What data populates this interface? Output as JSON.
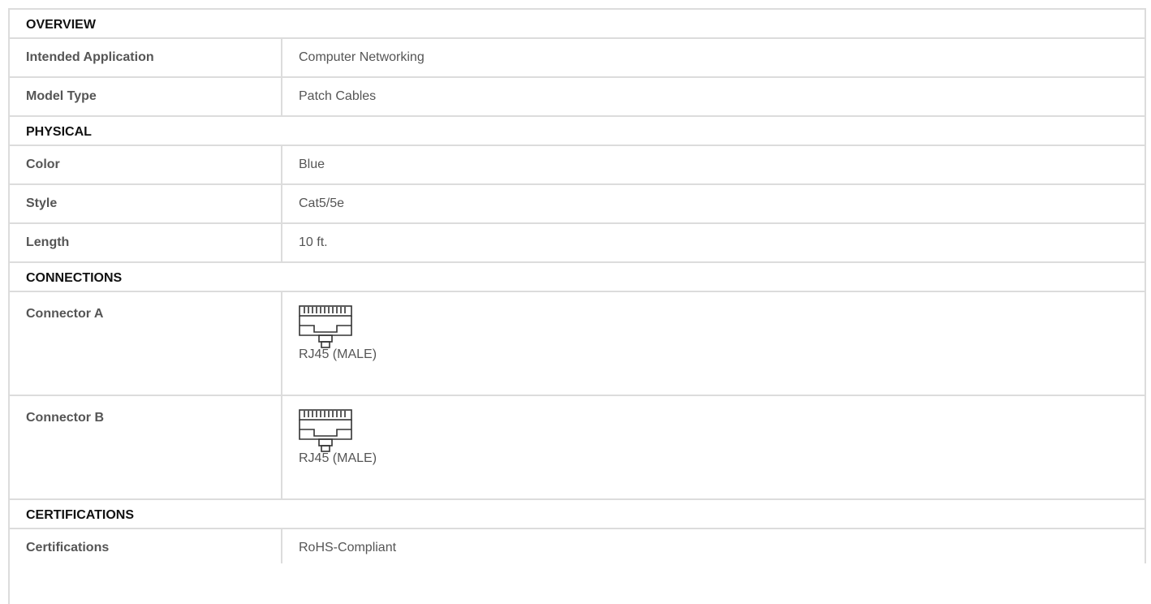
{
  "sections": [
    {
      "title": "OVERVIEW",
      "rows": [
        {
          "label": "Intended Application",
          "value": "Computer Networking"
        },
        {
          "label": "Model Type",
          "value": "Patch Cables"
        }
      ]
    },
    {
      "title": "PHYSICAL",
      "rows": [
        {
          "label": "Color",
          "value": "Blue"
        },
        {
          "label": "Style",
          "value": "Cat5/5e"
        },
        {
          "label": "Length",
          "value": "10 ft."
        }
      ]
    },
    {
      "title": "CONNECTIONS",
      "rows": [
        {
          "label": "Connector A",
          "value": "RJ45 (MALE)",
          "icon": "rj45-connector-icon"
        },
        {
          "label": "Connector B",
          "value": "RJ45 (MALE)",
          "icon": "rj45-connector-icon"
        }
      ]
    },
    {
      "title": "CERTIFICATIONS",
      "rows": [
        {
          "label": "Certifications",
          "value": "RoHS-Compliant"
        }
      ]
    }
  ],
  "colors": {
    "border": "#dcdcdc",
    "header_text": "#111111",
    "body_text": "#555555"
  }
}
